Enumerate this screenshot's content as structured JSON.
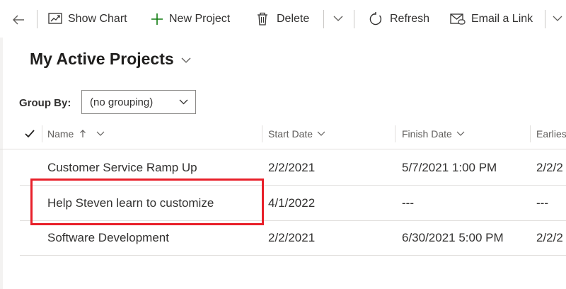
{
  "toolbar": {
    "show_chart": "Show Chart",
    "new_project": "New Project",
    "delete": "Delete",
    "refresh": "Refresh",
    "email_link": "Email a Link"
  },
  "view": {
    "title": "My Active Projects"
  },
  "group_by": {
    "label": "Group By:",
    "value": "(no grouping)"
  },
  "grid": {
    "columns": [
      "Name",
      "Start Date",
      "Finish Date",
      "Earlies"
    ],
    "rows": [
      {
        "name": "Customer Service Ramp Up",
        "start": "2/2/2021",
        "finish": "5/7/2021 1:00 PM",
        "earliest": "2/2/2"
      },
      {
        "name": "Help Steven learn to customize",
        "start": "4/1/2022",
        "finish": "---",
        "earliest": "---"
      },
      {
        "name": "Software Development",
        "start": "2/2/2021",
        "finish": "6/30/2021 5:00 PM",
        "earliest": "2/2/2"
      }
    ]
  },
  "colors": {
    "accent_green": "#107c10",
    "highlight_red": "#e8202a"
  }
}
